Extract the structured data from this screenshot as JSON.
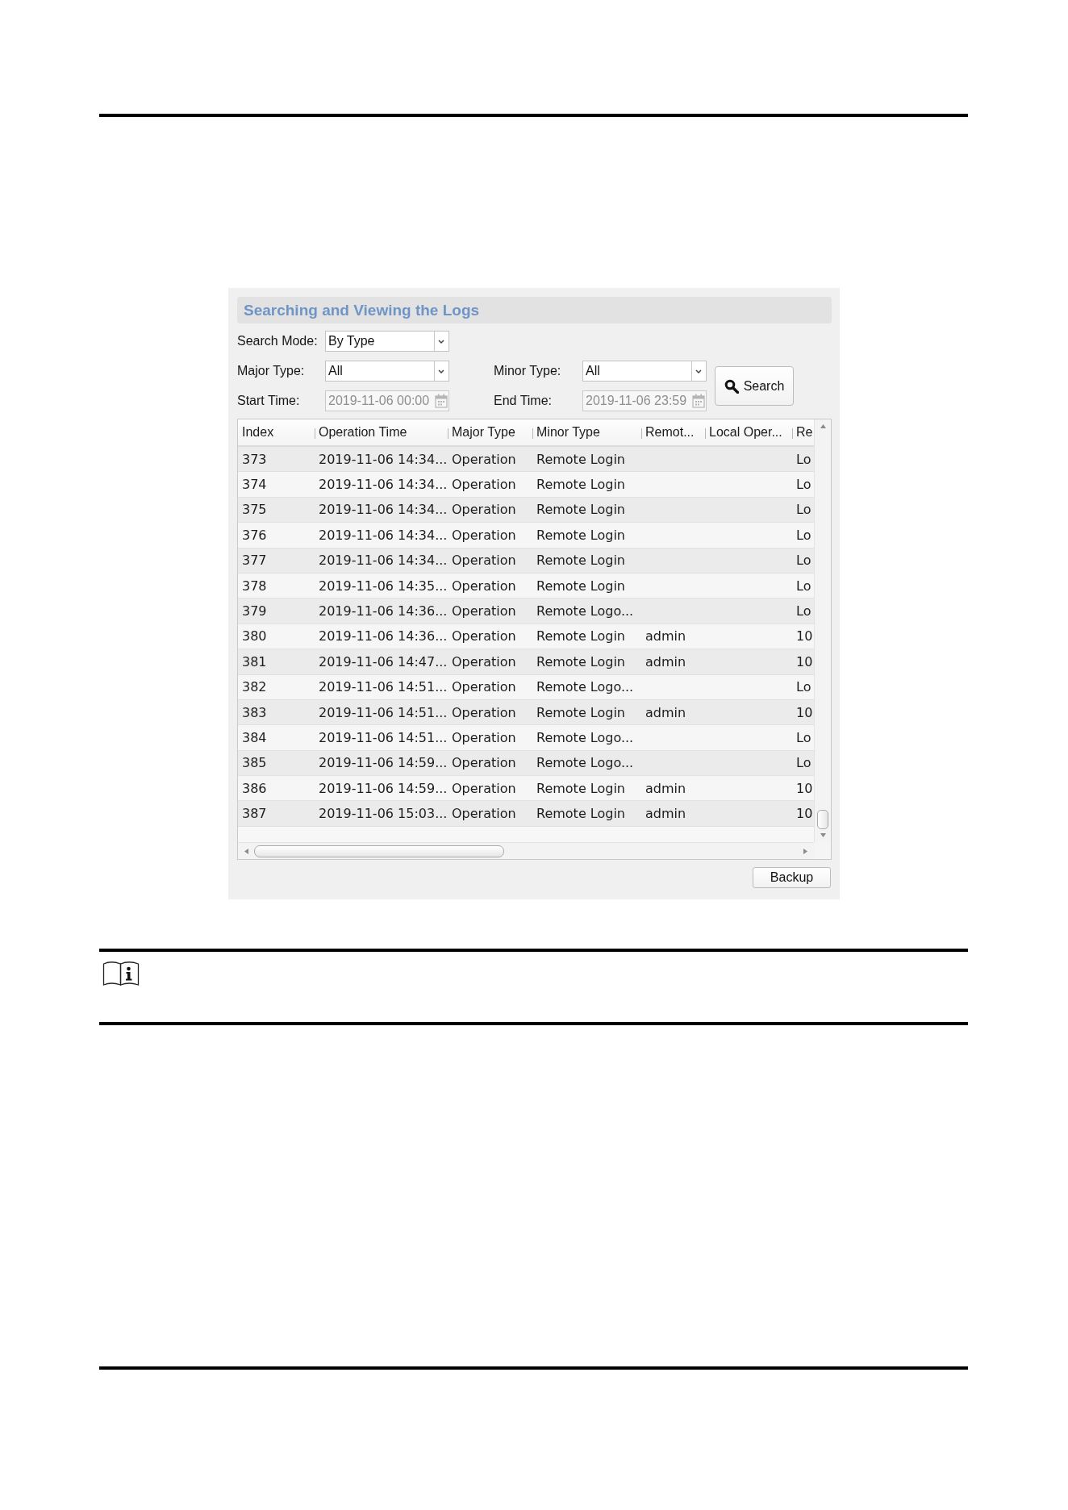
{
  "panel": {
    "title": "Searching and Viewing the Logs",
    "filter_rows": [
      [
        {
          "kind": "select",
          "label": "Search Mode:",
          "value": "By Type"
        }
      ],
      [
        {
          "kind": "select",
          "label": "Major Type:",
          "value": "All"
        },
        {
          "kind": "select",
          "label": "Minor Type:",
          "value": "All"
        }
      ],
      [
        {
          "kind": "date",
          "label": "Start Time:",
          "value": "2019-11-06 00:00",
          "disabled": true
        },
        {
          "kind": "date",
          "label": "End Time:",
          "value": "2019-11-06 23:59",
          "disabled": true
        }
      ]
    ],
    "search_button": "Search",
    "table": {
      "columns": [
        "Index",
        "Operation Time",
        "Major Type",
        "Minor Type",
        "Remot...",
        "Local Oper...",
        "Re"
      ],
      "rows": [
        [
          "373",
          "2019-11-06 14:34...",
          "Operation",
          "Remote Login",
          null,
          null,
          "Lo"
        ],
        [
          "374",
          "2019-11-06 14:34...",
          "Operation",
          "Remote Login",
          null,
          null,
          "Lo"
        ],
        [
          "375",
          "2019-11-06 14:34...",
          "Operation",
          "Remote Login",
          null,
          null,
          "Lo"
        ],
        [
          "376",
          "2019-11-06 14:34...",
          "Operation",
          "Remote Login",
          null,
          null,
          "Lo"
        ],
        [
          "377",
          "2019-11-06 14:34...",
          "Operation",
          "Remote Login",
          null,
          null,
          "Lo"
        ],
        [
          "378",
          "2019-11-06 14:35...",
          "Operation",
          "Remote Login",
          null,
          null,
          "Lo"
        ],
        [
          "379",
          "2019-11-06 14:36...",
          "Operation",
          "Remote Logo...",
          null,
          null,
          "Lo"
        ],
        [
          "380",
          "2019-11-06 14:36...",
          "Operation",
          "Remote Login",
          "admin",
          null,
          "10"
        ],
        [
          "381",
          "2019-11-06 14:47...",
          "Operation",
          "Remote Login",
          "admin",
          null,
          "10"
        ],
        [
          "382",
          "2019-11-06 14:51...",
          "Operation",
          "Remote Logo...",
          null,
          null,
          "Lo"
        ],
        [
          "383",
          "2019-11-06 14:51...",
          "Operation",
          "Remote Login",
          "admin",
          null,
          "10"
        ],
        [
          "384",
          "2019-11-06 14:51...",
          "Operation",
          "Remote Logo...",
          null,
          null,
          "Lo"
        ],
        [
          "385",
          "2019-11-06 14:59...",
          "Operation",
          "Remote Logo...",
          null,
          null,
          "Lo"
        ],
        [
          "386",
          "2019-11-06 14:59...",
          "Operation",
          "Remote Login",
          "admin",
          null,
          "10"
        ],
        [
          "387",
          "2019-11-06 15:03...",
          "Operation",
          "Remote Login",
          "admin",
          null,
          "10"
        ]
      ]
    },
    "backup_button": "Backup"
  }
}
